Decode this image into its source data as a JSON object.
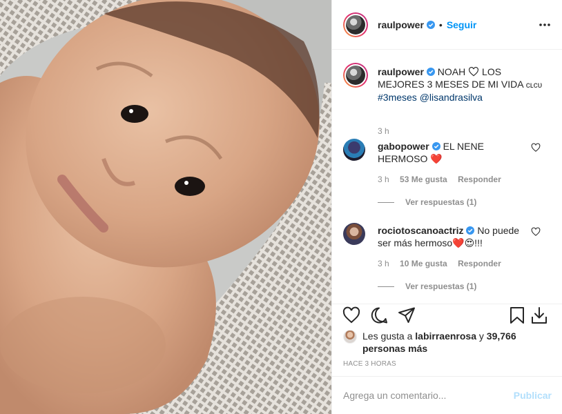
{
  "post": {
    "username": "raulpower",
    "follow_label": "Seguir",
    "dot": "•"
  },
  "caption": {
    "username": "raulpower",
    "text_before": "NOAH",
    "text_after": "LOS MEJORES 3 MESES DE MI VIDA",
    "small_word": "ᴄʟᴄᴜ",
    "hashtag": "#3meses",
    "mention": "@lisandrasilva",
    "time": "3 h"
  },
  "comments": [
    {
      "username": "gabopower",
      "text": "EL NENE HERMOSO",
      "emoji": "❤️",
      "time": "3 h",
      "likes": "53 Me gusta",
      "reply_label": "Responder",
      "view_replies": "Ver respuestas (1)"
    },
    {
      "username": "rociotoscanoactriz",
      "text": "No puede ser más hermoso",
      "emoji": "❤️😍!!!",
      "time": "3 h",
      "likes": "10 Me gusta",
      "reply_label": "Responder",
      "view_replies": "Ver respuestas (1)"
    }
  ],
  "likes": {
    "prefix": "Les gusta a",
    "user": "labirraenrosa",
    "joiner": "y",
    "others": "39,766 personas más"
  },
  "time_ago": "HACE 3 HORAS",
  "add_comment": {
    "placeholder": "Agrega un comentario...",
    "publish_label": "Publicar"
  },
  "colors": {
    "accent": "#0095f6",
    "text": "#262626",
    "muted": "#8e8e8e",
    "heart": "#ed4956",
    "publish_disabled": "#b2dffc"
  },
  "icons": [
    "verified-badge-icon",
    "more-options-icon",
    "heart-icon",
    "comment-icon",
    "share-icon",
    "bookmark-icon",
    "download-icon"
  ]
}
